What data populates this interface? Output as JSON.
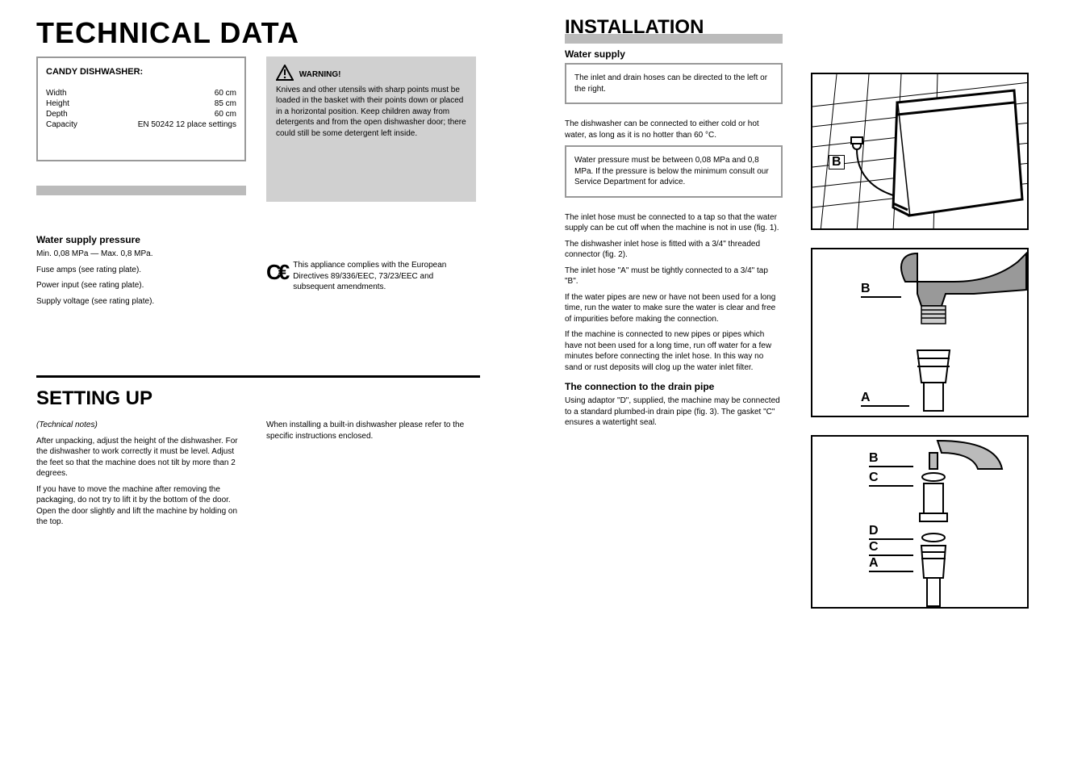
{
  "main_title": "TECHNICAL DATA",
  "subheader": {
    "brand_label": "CANDY DISHWASHER:",
    "line1": "Width",
    "line1v": "60 cm",
    "line2": "Height",
    "line2v": "85 cm",
    "line3": "Depth",
    "line3v": "60 cm",
    "line4": "Capacity",
    "line4v": "EN 50242 12 place settings"
  },
  "gray_bar_label": "",
  "col1": {
    "h": "Water supply pressure",
    "p1": "Min. 0,08 MPa — Max. 0,8 MPa.",
    "p2": "Fuse amps (see rating plate).",
    "p3": "Power input (see rating plate).",
    "p4": "Supply voltage (see rating plate)."
  },
  "warning": {
    "line1": "WARNING!",
    "body": "Knives and other utensils with sharp points must be loaded in the basket with their points down or placed in a horizontal position. Keep children away from detergents and from the open dishwasher door; there could still be some detergent left inside."
  },
  "ce": {
    "text": "This appliance complies with the European Directives 89/336/EEC, 73/23/EEC and subsequent amendments."
  },
  "setting_up": "SETTING UP",
  "setup_p": "(Technical notes)",
  "col1b": {
    "p1": "After unpacking, adjust the height of the dishwasher. For the dishwasher to work correctly it must be level. Adjust the feet so that the machine does not tilt by more than 2 degrees.",
    "p2": "If you have to move the machine after removing the packaging, do not try to lift it by the bottom of the door. Open the door slightly and lift the machine by holding on the top."
  },
  "col2c": {
    "p1": "When installing a built-in dishwasher please refer to the specific instructions enclosed.",
    "p2": ""
  },
  "inst_title": "INSTALLATION",
  "col3": {
    "h1": "Water supply",
    "box1": "The inlet and drain hoses can be directed to the left or the right.",
    "mid": "The dishwasher can be connected to either cold or hot water, as long as it is no hotter than 60 °C.",
    "box2": "Water pressure must be between 0,08 MPa and 0,8 MPa. If the pressure is below the minimum consult our Service Department for advice.",
    "p1": "The inlet hose must be connected to a tap so that the water supply can be cut off when the machine is not in use (fig. 1).",
    "p2": "The dishwasher inlet hose is fitted with a 3/4\" threaded connector (fig. 2).",
    "p3": "The inlet hose \"A\" must be tightly connected to a 3/4\" tap \"B\".",
    "p4": "If the water pipes are new or have not been used for a long time, run the water to make sure the water is clear and free of impurities before making the connection.",
    "p5": "If the machine is connected to new pipes or pipes which have not been used for a long time, run off water for a few minutes before connecting the inlet hose. In this way no sand or rust deposits will clog up the water inlet filter.",
    "h2": "The connection to the drain pipe",
    "p6": "Using adaptor \"D\", supplied, the machine may be connected to a standard plumbed-in drain pipe (fig. 3). The gasket \"C\" ensures a watertight seal."
  }
}
